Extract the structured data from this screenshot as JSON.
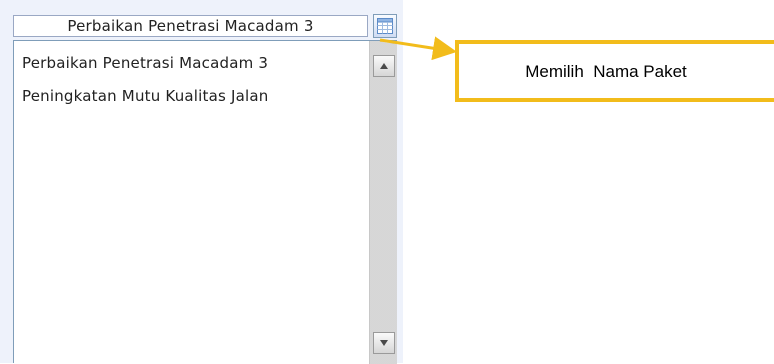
{
  "combo": {
    "selected_value": "Perbaikan Penetrasi Macadam 3"
  },
  "list": {
    "items": [
      {
        "label": "Perbaikan Penetrasi Macadam 3"
      },
      {
        "label": "Peningkatan Mutu Kualitas Jalan"
      }
    ]
  },
  "callout": {
    "text": "Memilih  Nama Paket",
    "color": "#f2bc1b"
  },
  "icons": {
    "dropdown_button": "table-icon",
    "scroll_up": "arrow-up-icon",
    "scroll_down": "arrow-down-icon"
  }
}
